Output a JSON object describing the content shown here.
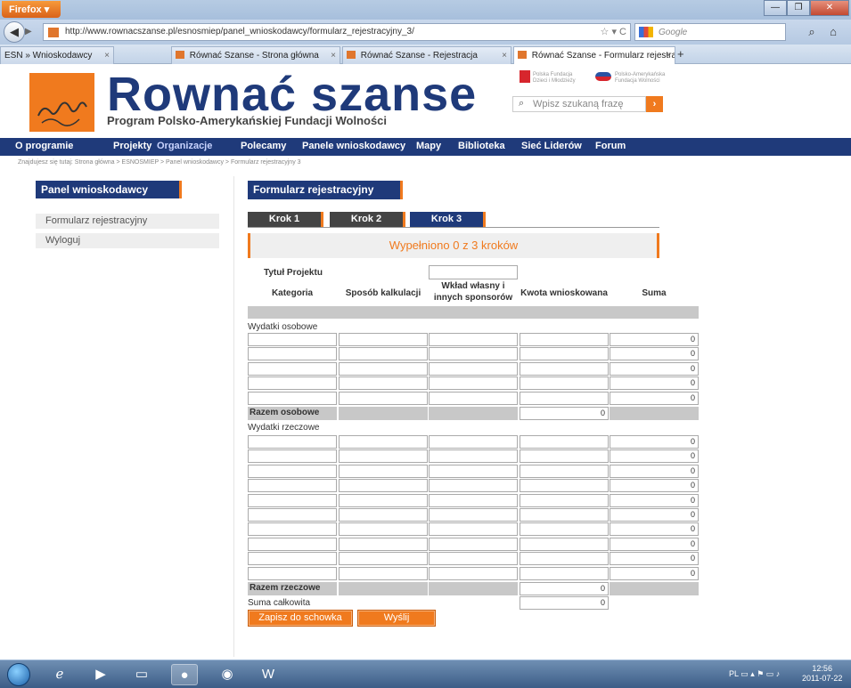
{
  "browser": {
    "menu_button": "Firefox ▾",
    "url": "http://www.rownacszanse.pl/esnosmiep/panel_wnioskodawcy/formularz_rejestracyjny_3/",
    "search_placeholder": "Google",
    "tabs": [
      {
        "label": "ESN » Wnioskodawcy",
        "active": false
      },
      {
        "label": "Równać Szanse - Strona główna",
        "active": false
      },
      {
        "label": "Równać Szanse - Rejestracja",
        "active": false
      },
      {
        "label": "Równać Szanse - Formularz rejestrac...",
        "active": true
      }
    ],
    "new_tab": "+"
  },
  "header": {
    "logo_title": "Rownać szanse",
    "logo_subtitle": "Program Polsko-Amerykańskiej Fundacji Wolności",
    "partner1": "Polska Fundacja Dzieci i Młodzieży",
    "partner2": "Polsko-Amerykańska Fundacja Wolności",
    "search_placeholder": "Wpisz szukaną frazę",
    "search_go": "›"
  },
  "menu": [
    "O programie",
    "Projekty",
    "Organizacje",
    "Polecamy",
    "Panele wnioskodawcy",
    "Mapy",
    "Biblioteka",
    "Sieć Liderów",
    "Forum"
  ],
  "breadcrumb": "Znajdujesz się tutaj:   Strona główna > ESNOSMIEP > Panel wnioskodawcy > Formularz rejestracyjny 3",
  "sidebar": {
    "title": "Panel wnioskodawcy",
    "items": [
      "Formularz rejestracyjny",
      "Wyloguj"
    ]
  },
  "form": {
    "title": "Formularz rejestracyjny",
    "steps": [
      "Krok 1",
      "Krok 2",
      "Krok 3"
    ],
    "progress": "Wypełniono 0 z 3 kroków",
    "project_title_label": "Tytuł Projektu",
    "columns": [
      "Kategoria",
      "Sposób kalkulacji",
      "Wkład własny i innych sponsorów",
      "Kwota wnioskowana",
      "Suma"
    ],
    "section_personal": "Wydatki osobowe",
    "personal_rows": [
      "0",
      "0",
      "0",
      "0",
      "0"
    ],
    "personal_total_label": "Razem osobowe",
    "personal_total": "0",
    "section_material": "Wydatki rzeczowe",
    "material_rows": [
      "0",
      "0",
      "0",
      "0",
      "0",
      "0",
      "0",
      "0",
      "0",
      "0"
    ],
    "material_total_label": "Razem rzeczowe",
    "material_total": "0",
    "grand_total_label": "Suma całkowita",
    "grand_total": "0",
    "save_button": "Zapisz do schowka",
    "send_button": "Wyślij"
  },
  "taskbar": {
    "lang": "PL",
    "time": "12:56",
    "date": "2011-07-22"
  }
}
